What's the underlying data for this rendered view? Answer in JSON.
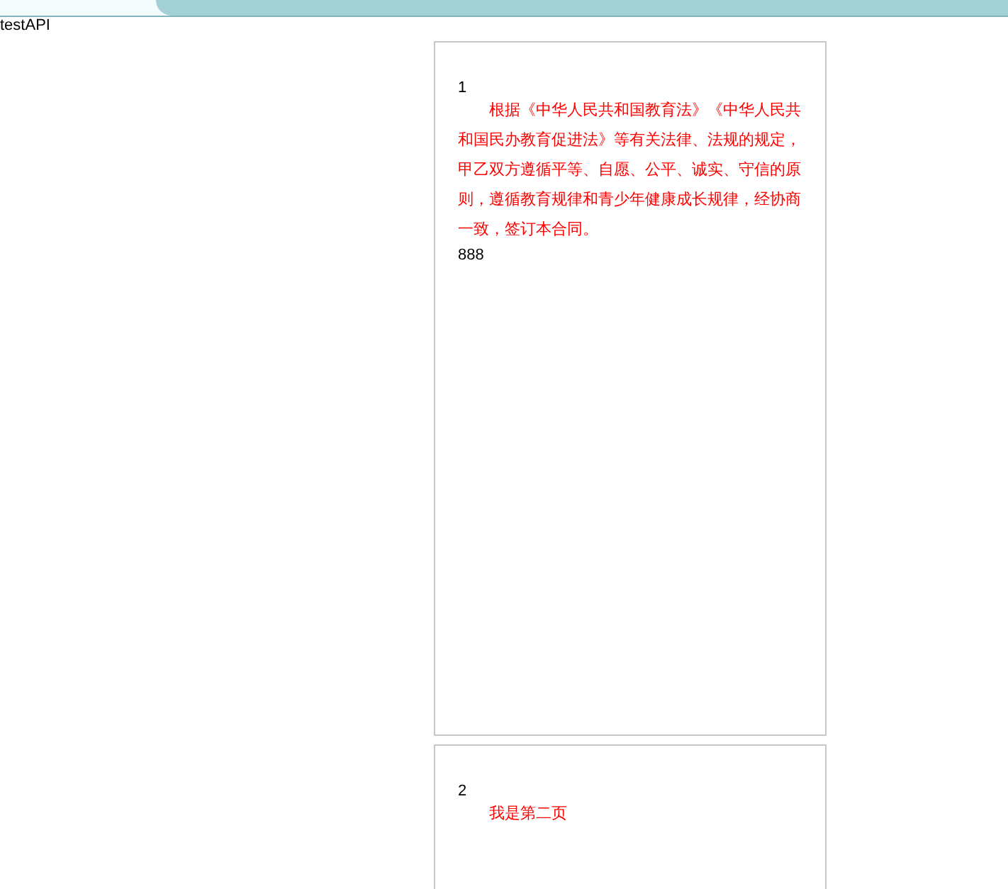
{
  "title": "testAPI",
  "pages": [
    {
      "number": "1",
      "paragraph": "根据《中华人民共和国教育法》《中华人民共和国民办教育促进法》等有关法律、法规的规定，甲乙双方遵循平等、自愿、公平、诚实、守信的原则，遵循教育规律和青少年健康成长规律，经协商一致，签订本合同。",
      "footer": "888"
    },
    {
      "number": "2",
      "paragraph": "我是第二页"
    }
  ]
}
